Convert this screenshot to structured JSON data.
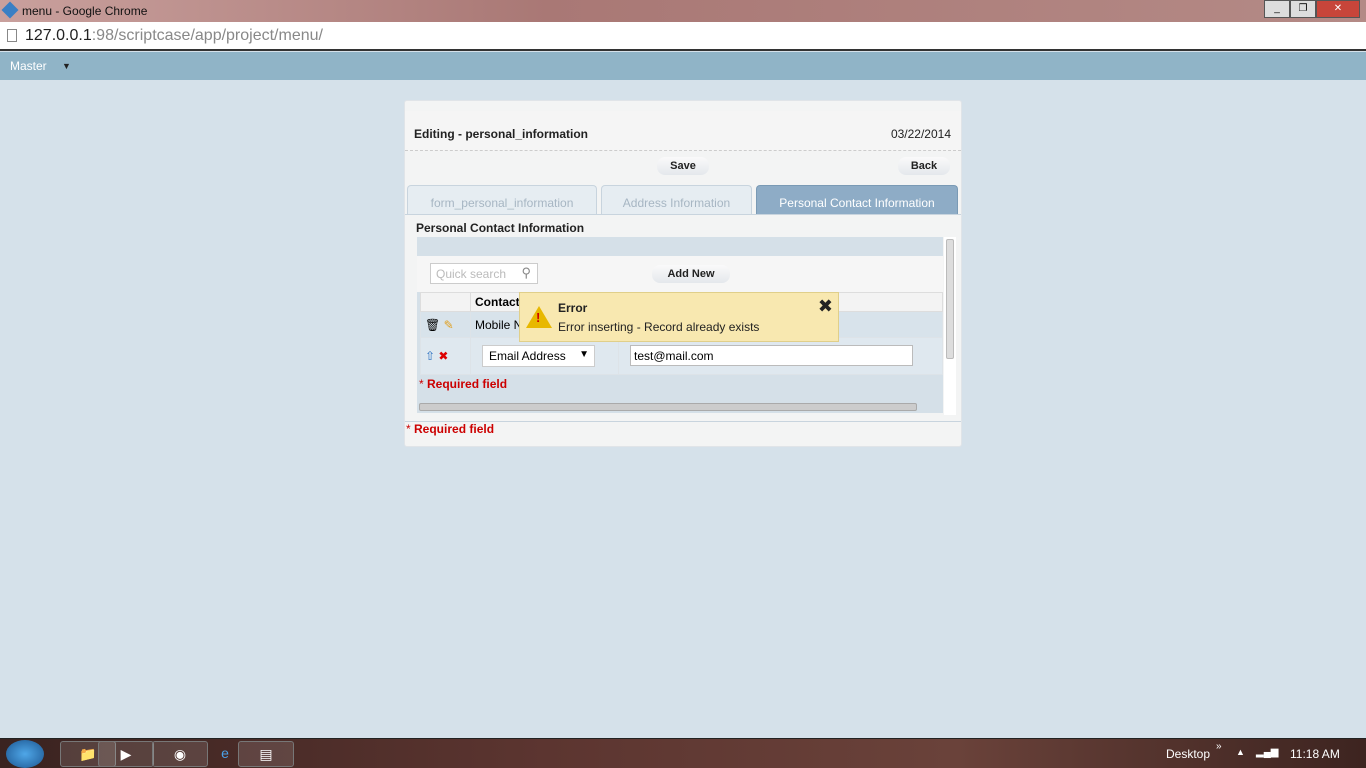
{
  "browser": {
    "title": "menu - Google Chrome",
    "url_host": "127.0.0.1",
    "url_rest": ":98/scriptcase/app/project/menu/"
  },
  "menu": {
    "item": "Master"
  },
  "form": {
    "title": "Editing - personal_information",
    "date": "03/22/2014",
    "save": "Save",
    "back": "Back",
    "tabs": [
      {
        "label": "form_personal_information"
      },
      {
        "label": "Address Information"
      },
      {
        "label": "Personal Contact Information"
      }
    ],
    "section": "Personal Contact Information",
    "quick_search_placeholder": "Quick search",
    "add_new": "Add New",
    "columns": [
      "Contact"
    ],
    "rows": [
      {
        "contact": "Mobile N"
      }
    ],
    "new_row": {
      "contact_type": "Email Address",
      "value": "test@mail.com"
    },
    "required_mark": "*",
    "required": "Required field"
  },
  "error": {
    "title": "Error",
    "message": "Error inserting - Record already exists"
  },
  "taskbar": {
    "desktop": "Desktop",
    "time": "11:18 AM"
  }
}
